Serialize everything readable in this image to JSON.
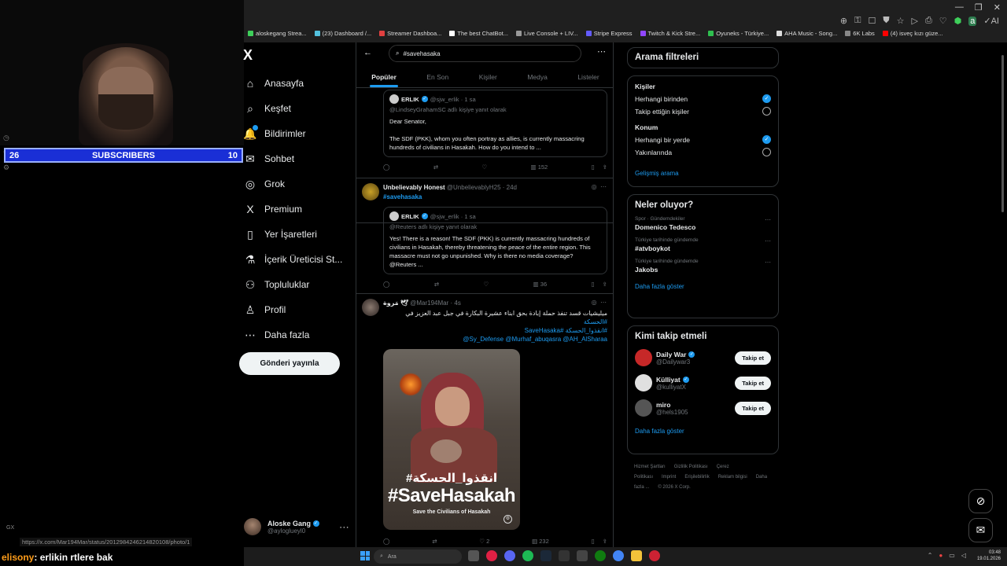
{
  "stream": {
    "subscribers_left": "26",
    "subscribers_label": "SUBSCRIBERS",
    "subscribers_right": "10",
    "gx_label": "GX",
    "chat_user": "elisony",
    "chat_message": ": erlikin rtlere bak",
    "status_url": "https://x.com/Mar194Mar/status/2012984246214820108/photo/1"
  },
  "bookmarks": [
    {
      "label": "aloskegang Strea...",
      "color": "#3ecf5a"
    },
    {
      "label": "(23) Dashboard /...",
      "color": "#53c1de"
    },
    {
      "label": "Streamer Dashboa...",
      "color": "#e04040"
    },
    {
      "label": "The best ChatBot...",
      "color": "#ffffff"
    },
    {
      "label": "Live Console + LIV...",
      "color": "#999999"
    },
    {
      "label": "Stripe Express",
      "color": "#635bff"
    },
    {
      "label": "Twitch & Kick Stre...",
      "color": "#9146ff"
    },
    {
      "label": "Oyuneks - Türkiye...",
      "color": "#2fbf4f"
    },
    {
      "label": "AHA Music - Song...",
      "color": "#dddddd"
    },
    {
      "label": "6K Labs",
      "color": "#888888"
    },
    {
      "label": "(4) isveç kızı güze...",
      "color": "#ff0000"
    }
  ],
  "x": {
    "logo": "X",
    "nav": [
      {
        "icon": "⌂",
        "label": "Anasayfa"
      },
      {
        "icon": "⌕",
        "label": "Keşfet"
      },
      {
        "icon": "🔔",
        "label": "Bildirimler"
      },
      {
        "icon": "✉",
        "label": "Sohbet"
      },
      {
        "icon": "◎",
        "label": "Grok"
      },
      {
        "icon": "X",
        "label": "Premium"
      },
      {
        "icon": "▯",
        "label": "Yer İşaretleri"
      },
      {
        "icon": "⚗",
        "label": "İçerik Üreticisi St..."
      },
      {
        "icon": "⚇",
        "label": "Topluluklar"
      },
      {
        "icon": "♙",
        "label": "Profil"
      },
      {
        "icon": "⋯",
        "label": "Daha fazla"
      }
    ],
    "post_button": "Gönderi yayınla",
    "account": {
      "name": "Aloske Gang",
      "handle": "@ayloglueyl0"
    }
  },
  "search": {
    "query": "#savehasaka",
    "tabs": [
      "Popüler",
      "En Son",
      "Kişiler",
      "Medya",
      "Listeler"
    ]
  },
  "tweets": [
    {
      "quote_name": "ERLIK",
      "quote_meta": "@sjw_erlik · 1 sa",
      "quote_reply": "@LindseyGrahamSC adlı kişiye yanıt olarak",
      "quote_text1": "Dear Senator,",
      "quote_text2": "The SDF (PKK), whom you often portray as allies, is currently massacring hundreds of civilians in Hasakah. How do you intend to ...",
      "views": "152"
    },
    {
      "name": "Unbelievably Honest",
      "meta": "@UnbelievablyH25 · 24d",
      "hashtag": "#savehasaka",
      "quote_name": "ERLIK",
      "quote_meta": "@sjw_erlik · 1 sa",
      "quote_reply": "@Reuters adlı kişiye yanıt olarak",
      "quote_text": "Yes! There is a reason! The SDF (PKK) is currently massacring hundreds of civilians in Hasakah, thereby threatening the peace of the entire region. This massacre must not go unpunished. Why is there no media coverage? @Reuters ...",
      "views": "36"
    },
    {
      "name": "مَروة 🕊",
      "meta": "@Mar194Mar · 4s",
      "text_ar": "ميليشيات قسد تنفذ حملة إبادة بحق ابناء عشيرة البكارة في جبل عبد العزيز في",
      "hashtag1": "#الحسكة",
      "hashtag2": "#انقذوا_الحسكة #SaveHasaka",
      "mentions": "@Sy_Defense @Murhaf_abuqasra @AH_AlSharaa",
      "image_ar": "#انقذوا_الحسكة",
      "image_en": "#SaveHasakah",
      "image_sub": "Save the Civilians of Hasakah",
      "likes": "2",
      "views": "232"
    }
  ],
  "filters": {
    "title": "Arama filtreleri",
    "people_label": "Kişiler",
    "people_opt1": "Herhangi birinden",
    "people_opt2": "Takip ettiğin kişiler",
    "location_label": "Konum",
    "loc_opt1": "Herhangi bir yerde",
    "loc_opt2": "Yakınlarında",
    "advanced": "Gelişmiş arama"
  },
  "trends": {
    "title": "Neler oluyor?",
    "items": [
      {
        "cat": "Spor · Gündemdekiler",
        "name": "Domenico Tedesco"
      },
      {
        "cat": "Türkiye tarihinde gündemde",
        "name": "#atvboykot"
      },
      {
        "cat": "Türkiye tarihinde gündemde",
        "name": "Jakobs"
      }
    ],
    "more": "Daha fazla göster"
  },
  "who_to_follow": {
    "title": "Kimi takip etmeli",
    "items": [
      {
        "name": "Daily War",
        "handle": "@Dailywar3",
        "button": "Takip et"
      },
      {
        "name": "Külliyat",
        "handle": "@kulliyatX",
        "button": "Takip et"
      },
      {
        "name": "miro",
        "handle": "@hels1905",
        "button": "Takip et"
      }
    ],
    "more": "Daha fazla göster"
  },
  "footer": {
    "links": [
      "Hizmet Şartları",
      "Gizlilik Politikası",
      "Çerez Politikası",
      "Imprint",
      "Erişilebilirlik",
      "Reklam bilgisi",
      "Daha fazla ...",
      "© 2026 X Corp."
    ]
  },
  "taskbar": {
    "search": "Ara",
    "time": "03:48",
    "date": "19.01.2026"
  }
}
